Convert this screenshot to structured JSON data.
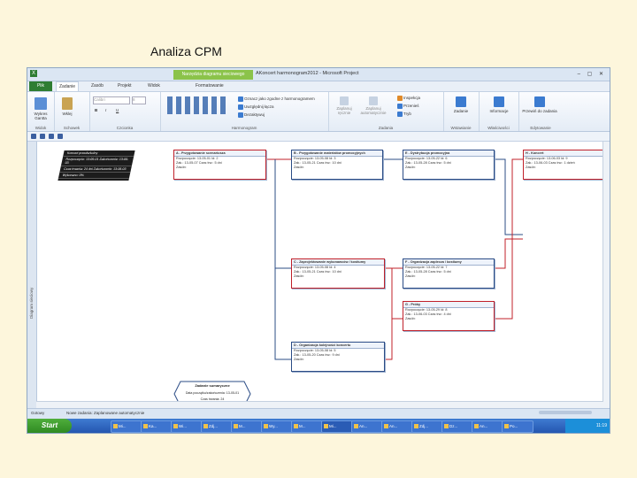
{
  "slide": {
    "title": "Analiza CPM"
  },
  "window": {
    "app_icon": "X",
    "contextual_tab": "Narzędzia diagramu sieciowego",
    "title": "AKoncert harmonogram2012 - Microsoft Project",
    "controls": "– ▢ ✕"
  },
  "tabs": {
    "file": "Plik",
    "items": [
      "Zadanie",
      "Zasób",
      "Projekt",
      "Widok",
      "Formatowanie"
    ]
  },
  "ribbon": {
    "groups": [
      {
        "label": "Widok",
        "buttons": [
          "Wykres Gantta"
        ]
      },
      {
        "label": "Schowek",
        "buttons": [
          "Wklej"
        ]
      },
      {
        "label": "Czcionka",
        "buttons": [
          "Calibri",
          "8",
          "B",
          "I",
          "U"
        ]
      },
      {
        "label": "Harmonogram",
        "buttons": [
          "Oznacz jako zgodne z harmonogramem",
          "Uwzględnij łącza",
          "Dezaktywuj"
        ]
      },
      {
        "label": "Zadania",
        "buttons": [
          "Zaplanuj ręcznie",
          "Zaplanuj automatycznie",
          "Inspekcja",
          "Przenieś",
          "Tryb"
        ]
      },
      {
        "label": "Wstawianie",
        "buttons": [
          "Zadanie"
        ]
      },
      {
        "label": "Właściwości",
        "buttons": [
          "Informacje"
        ]
      },
      {
        "label": "Edytowanie",
        "buttons": [
          "Przewiń do zadania"
        ]
      }
    ]
  },
  "canvas": {
    "vertical_label": "Diagram sieciowy",
    "legend": [
      "Koncert przedszkolny",
      "Rozpoczęcie: 13-05-01  Zakończenie: 13-06-03",
      "Czas trwania: 24 dni  Zakończenie: 13-06-03",
      "Wykonano: 0%"
    ],
    "nodes": [
      {
        "id": "A",
        "title": "A - Przygotowanie scenariusza",
        "row1": "Rozpoczęcie: 13-05-01  Id: 2",
        "row2": "Zak.: 13-05-07  Czas trw.: 5 dni",
        "row3": "Zasób:"
      },
      {
        "id": "B",
        "title": "B - Przygotowanie materiałów promocyjnych",
        "row1": "Rozpoczęcie: 13-05-08  Id: 3",
        "row2": "Zak.: 13-05-21  Czas trw.: 10 dni",
        "row3": "Zasób:"
      },
      {
        "id": "E",
        "title": "E - Dystrybucja promocyjna",
        "row1": "Rozpoczęcie: 13-05-22  Id: 6",
        "row2": "Zak.: 13-05-28  Czas trw.: 5 dni",
        "row3": "Zasób:"
      },
      {
        "id": "H",
        "title": "H - Koncert",
        "row1": "Rozpoczęcie: 13-06-03  Id: 9",
        "row2": "Zak.: 13-06-03  Czas trw.: 1 dzień",
        "row3": "Zasób:"
      },
      {
        "id": "C",
        "title": "C - Zaprojektowanie wykonawców / kostiumy",
        "row1": "Rozpoczęcie: 13-05-08  Id: 4",
        "row2": "Zak.: 13-05-21  Czas trw.: 10 dni",
        "row3": "Zasób:"
      },
      {
        "id": "F",
        "title": "F - Organizacja zaplecza / kostiumy",
        "row1": "Rozpoczęcie: 13-05-22  Id: 7",
        "row2": "Zak.: 13-05-28  Czas trw.: 5 dni",
        "row3": "Zasób:"
      },
      {
        "id": "G",
        "title": "G - Próby",
        "row1": "Rozpoczęcie: 13-05-29  Id: 8",
        "row2": "Zak.: 13-06-03  Czas trw.: 4 dni",
        "row3": "Zasób:"
      },
      {
        "id": "D",
        "title": "D - Organizacja kolejności koncertu",
        "row1": "Rozpoczęcie: 13-05-08  Id: 5",
        "row2": "Zak.: 13-05-20  Czas trw.: 9 dni",
        "row3": "Zasób:"
      }
    ],
    "milestone": {
      "title": "Zadanie sumaryczne",
      "line1": "Data początku/zakończenia: 13-05-01",
      "line2": "Czas trwania: 24"
    }
  },
  "statusbar": {
    "left": "Gotowy",
    "middle": "Nowe zadania: Zaplanowane automatycznie",
    "zoom": "+  –"
  },
  "taskbar": {
    "start": "Start",
    "items": [
      "Mi...",
      "Ka...",
      "Wi...",
      "Zdj...",
      "M...",
      "Wy...",
      "M...",
      "Mi...",
      "An...",
      "An...",
      "Zdj...",
      "Dz...",
      "An...",
      "Po..."
    ],
    "clock": "11:19"
  }
}
